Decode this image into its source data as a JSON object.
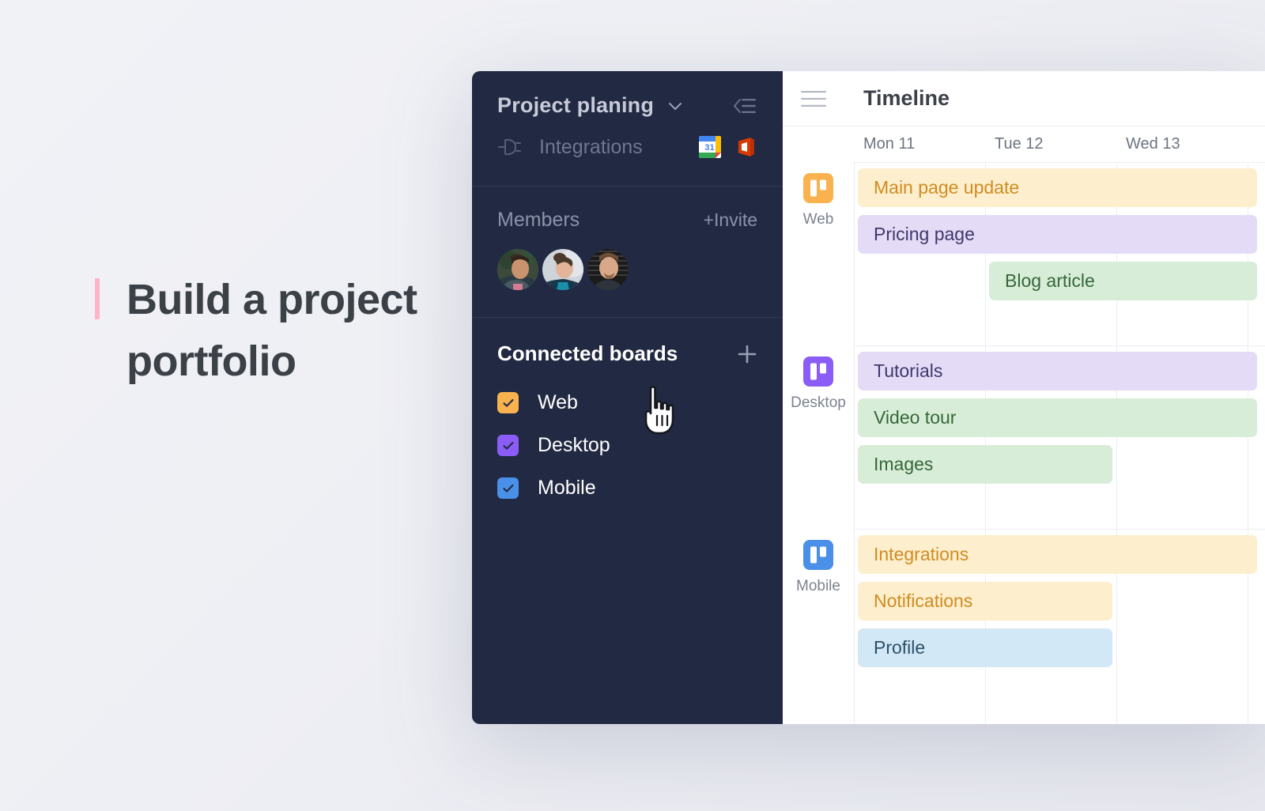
{
  "hero": {
    "title": "Build a project portfolio",
    "accent_color": "#ffb3c7",
    "text_color": "#3c4148"
  },
  "sidebar": {
    "project_title": "Project planing",
    "chevron_icon": "chevron-down-icon",
    "collapse_icon": "collapse-sidebar-icon",
    "integrations": {
      "icon": "plug-icon",
      "label": "Integrations",
      "apps": [
        {
          "name": "google-calendar-icon",
          "label": "Google Calendar",
          "day": "31"
        },
        {
          "name": "microsoft-office-icon",
          "label": "Microsoft Office"
        }
      ]
    },
    "members": {
      "label": "Members",
      "invite_label": "+Invite",
      "avatars": [
        {
          "name": "member-avatar-1"
        },
        {
          "name": "member-avatar-2"
        },
        {
          "name": "member-avatar-3"
        }
      ]
    },
    "connected_boards": {
      "title": "Connected boards",
      "add_icon": "plus-icon",
      "items": [
        {
          "label": "Web",
          "checked": true,
          "color": "#f9b24e"
        },
        {
          "label": "Desktop",
          "checked": true,
          "color": "#8b5cf6"
        },
        {
          "label": "Mobile",
          "checked": true,
          "color": "#4a90e8"
        }
      ]
    },
    "background_color": "#222942"
  },
  "timeline": {
    "menu_icon": "hamburger-menu-icon",
    "title": "Timeline",
    "days": [
      "Mon 11",
      "Tue 12",
      "Wed 13"
    ],
    "rows": [
      {
        "board": "Web",
        "board_icon": "trello-board-icon",
        "board_color": "#f9b24e",
        "tasks": [
          {
            "label": "Main page update",
            "bg": "#fdeecd",
            "fg": "#d08c20",
            "start_day": 0,
            "span_days": 3.1,
            "lane": 0
          },
          {
            "label": "Pricing page",
            "bg": "#e4dcf7",
            "fg": "#40376b",
            "start_day": 0,
            "span_days": 3.1,
            "lane": 1
          },
          {
            "label": "Blog article",
            "bg": "#d8edd8",
            "fg": "#35673a",
            "start_day": 1,
            "span_days": 2.1,
            "lane": 2
          }
        ]
      },
      {
        "board": "Desktop",
        "board_icon": "trello-board-icon",
        "board_color": "#8b5cf6",
        "tasks": [
          {
            "label": "Tutorials",
            "bg": "#e4dcf7",
            "fg": "#40376b",
            "start_day": 0,
            "span_days": 3.1,
            "lane": 0
          },
          {
            "label": "Video tour",
            "bg": "#d8edd8",
            "fg": "#35673a",
            "start_day": 0,
            "span_days": 3.1,
            "lane": 1
          },
          {
            "label": "Images",
            "bg": "#d8edd8",
            "fg": "#35673a",
            "start_day": 0,
            "span_days": 2,
            "lane": 2
          }
        ]
      },
      {
        "board": "Mobile",
        "board_icon": "trello-board-icon",
        "board_color": "#4a90e8",
        "tasks": [
          {
            "label": "Integrations",
            "bg": "#fdeecd",
            "fg": "#d08c20",
            "start_day": 0,
            "span_days": 3.1,
            "lane": 0
          },
          {
            "label": "Notifications",
            "bg": "#fdeecd",
            "fg": "#d08c20",
            "start_day": 0,
            "span_days": 2,
            "lane": 1
          },
          {
            "label": "Profile",
            "bg": "#d3e8f6",
            "fg": "#2b4e66",
            "start_day": 0,
            "span_days": 2,
            "lane": 2
          }
        ]
      }
    ]
  },
  "cursor": {
    "name": "pointing-hand-cursor"
  }
}
